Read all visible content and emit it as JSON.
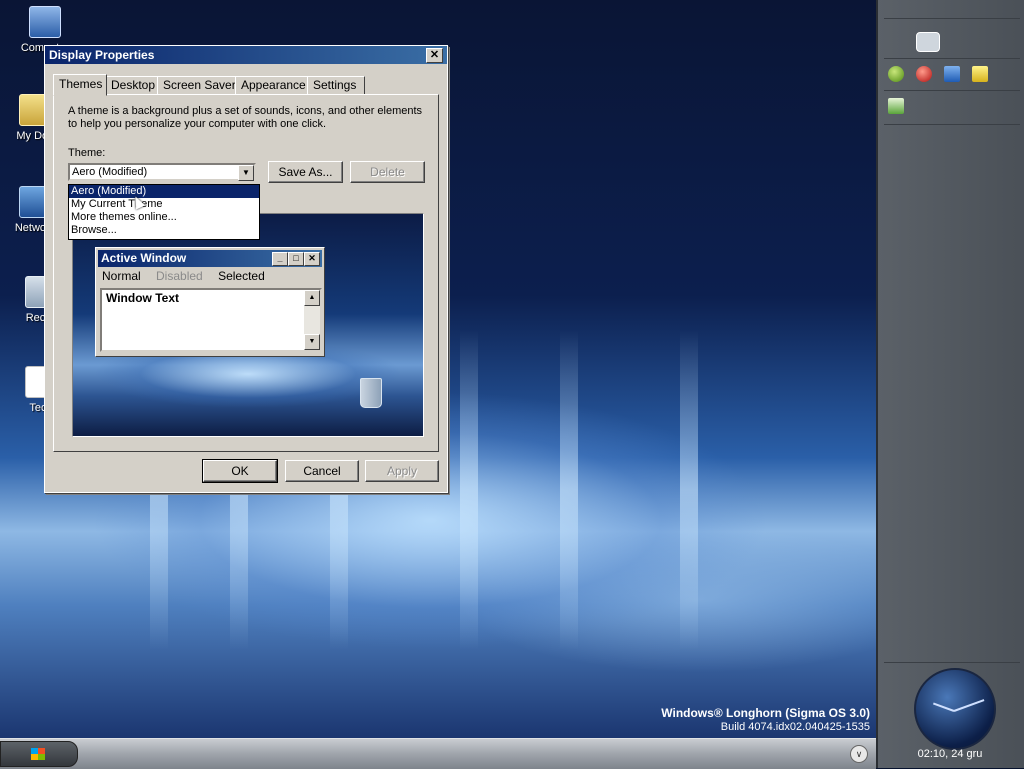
{
  "desktop": {
    "icons": [
      {
        "label": "Computer"
      },
      {
        "label": "My Doc"
      },
      {
        "label": "Network"
      },
      {
        "label": "Recyc"
      },
      {
        "label": "Tech"
      }
    ],
    "watermark": {
      "line1": "Windows® Longhorn (Sigma OS 3.0)",
      "line2": "Build 4074.idx02.040425-1535"
    }
  },
  "dialog": {
    "title": "Display Properties",
    "tabs": [
      "Themes",
      "Desktop",
      "Screen Saver",
      "Appearance",
      "Settings"
    ],
    "active_tab": "Themes",
    "description": "A theme is a background plus a set of sounds, icons, and other elements to help you personalize your computer with one click.",
    "theme_label": "Theme:",
    "theme_value": "Aero (Modified)",
    "buttons": {
      "save_as": "Save As...",
      "delete": "Delete",
      "ok": "OK",
      "cancel": "Cancel",
      "apply": "Apply"
    },
    "dropdown_options": [
      "Aero (Modified)",
      "My Current Theme",
      "More themes online...",
      "Browse..."
    ],
    "selected_option": "Aero (Modified)",
    "preview": {
      "window_title": "Active Window",
      "menu": [
        "Normal",
        "Disabled",
        "Selected"
      ],
      "window_text": "Window Text"
    }
  },
  "sidebar": {
    "clock_text": "02:10, 24 gru"
  },
  "colors": {
    "titlebar": "#0a246a",
    "dialog_face": "#d4d0c8",
    "selection": "#0a246a"
  }
}
